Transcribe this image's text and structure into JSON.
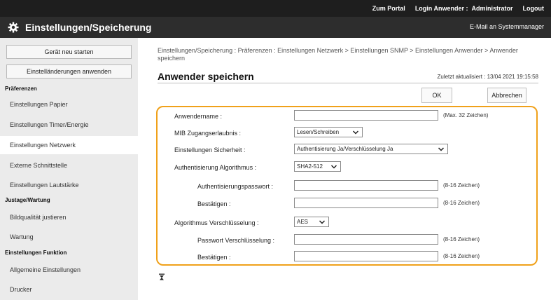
{
  "top_links": {
    "portal": "Zum Portal",
    "login": "Login Anwender :",
    "user": "Administrator",
    "logout": "Logout"
  },
  "header": {
    "title": "Einstellungen/Speicherung",
    "mail": "E-Mail an Systemmanager"
  },
  "sidebar": {
    "restart": "Gerät neu starten",
    "apply": "Einstelländerungen anwenden",
    "sections": [
      {
        "title": "Präferenzen"
      },
      {
        "title": "Justage/Wartung"
      },
      {
        "title": "Einstellungen Funktion"
      }
    ],
    "items": [
      {
        "label": "Einstellungen Papier"
      },
      {
        "label": "Einstellungen Timer/Energie"
      },
      {
        "label": "Einstellungen Netzwerk"
      },
      {
        "label": "Externe Schnittstelle"
      },
      {
        "label": "Einstellungen Lautstärke"
      },
      {
        "label": "Bildqualität justieren"
      },
      {
        "label": "Wartung"
      },
      {
        "label": "Allgemeine Einstellungen"
      },
      {
        "label": "Drucker"
      }
    ]
  },
  "main": {
    "breadcrumb": "Einstellungen/Speicherung : Präferenzen : Einstellungen Netzwerk > Einstellungen SNMP > Einstellungen Anwender > Anwender speichern",
    "title": "Anwender speichern",
    "updated": "Zuletzt aktualisiert : 13/04 2021 19:15:58",
    "ok": "OK",
    "cancel": "Abbrechen"
  },
  "form": {
    "username_label": "Anwendername :",
    "username_value": "",
    "username_hint": "(Max. 32 Zeichen)",
    "mib_label": "MIB Zugangserlaubnis :",
    "mib_value": "Lesen/Schreiben",
    "security_label": "Einstellungen Sicherheit :",
    "security_value": "Authentisierung Ja/Verschlüsselung Ja",
    "auth_algo_label": "Authentisierung Algorithmus :",
    "auth_algo_value": "SHA2-512",
    "auth_pw_label": "Authentisierungspasswort :",
    "auth_pw_hint": "(8-16 Zeichen)",
    "confirm_label": "Bestätigen :",
    "confirm_hint": "(8-16 Zeichen)",
    "enc_algo_label": "Algorithmus Verschlüsselung :",
    "enc_algo_value": "AES",
    "enc_pw_label": "Passwort Verschlüsselung :",
    "enc_pw_hint": "(8-16 Zeichen)",
    "confirm2_label": "Bestätigen :",
    "confirm2_hint": "(8-16 Zeichen)"
  },
  "colors": {
    "accent": "#f0a11a",
    "topbar": "#1e1e1e",
    "titlebar": "#2d2d2d",
    "sidebar": "#ebebeb"
  },
  "icons": {
    "header": "gear-icon",
    "dropdown": "chevron-down-icon",
    "collapse": "collapse-icon"
  }
}
